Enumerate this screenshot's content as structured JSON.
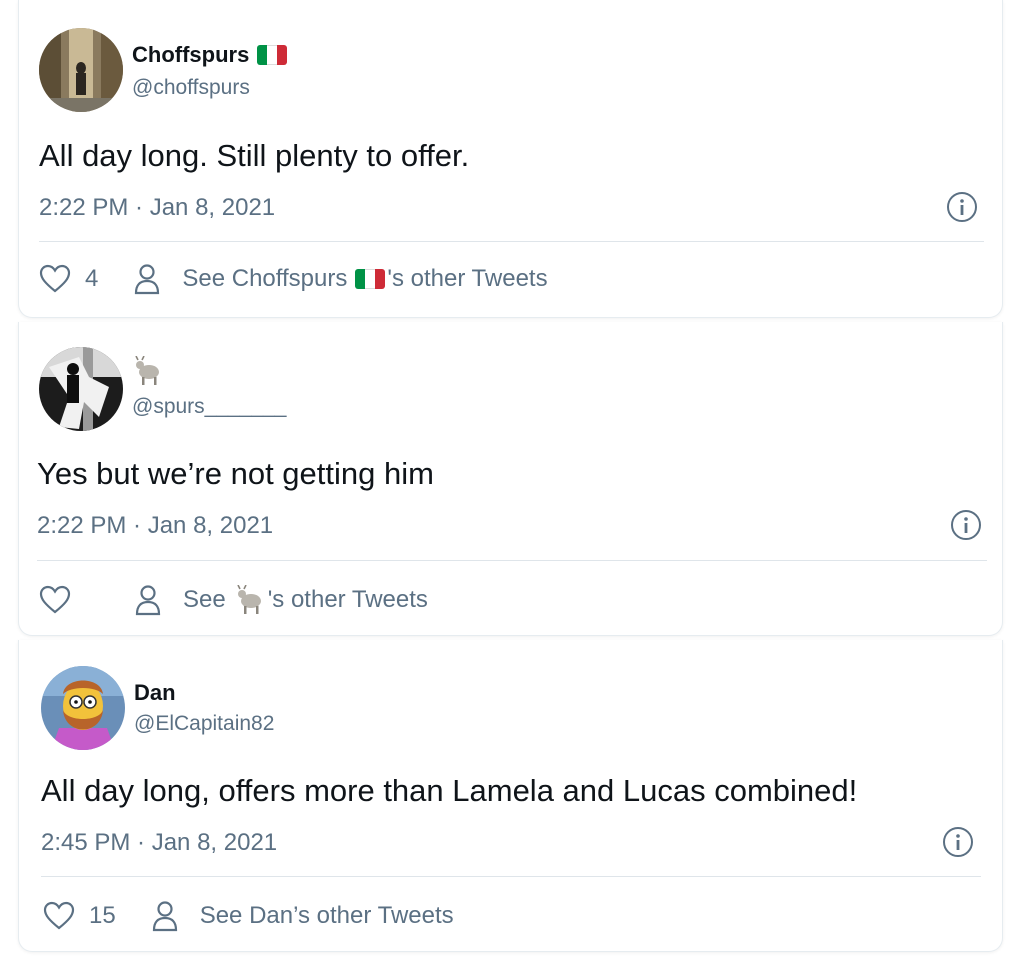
{
  "tweets": [
    {
      "name": "Choffspurs",
      "name_emoji": "italy-flag",
      "handle": "@choffspurs",
      "text": "All day long. Still plenty to offer.",
      "time": "2:22 PM · Jan 8, 2021",
      "likes": "4",
      "see_prefix": "See Choffspurs",
      "see_suffix": "'s other Tweets"
    },
    {
      "name": "",
      "name_emoji": "goat",
      "handle": "@spurs_______",
      "text": "Yes but we’re not getting him",
      "time": "2:22 PM · Jan 8, 2021",
      "likes": "",
      "see_prefix": "See",
      "see_suffix": "'s other Tweets"
    },
    {
      "name": "Dan",
      "name_emoji": "",
      "handle": "@ElCapitain82",
      "text": "All day long, offers more than Lamela and Lucas combined!",
      "time": "2:45 PM · Jan 8, 2021",
      "likes": "15",
      "see_prefix": "See Dan’s other Tweets",
      "see_suffix": ""
    }
  ],
  "colors": {
    "text": "#0f1419",
    "muted": "#5b7083",
    "divider": "#dfe5ea",
    "flag_green": "#009246",
    "flag_white": "#ffffff",
    "flag_red": "#ce2b37"
  }
}
